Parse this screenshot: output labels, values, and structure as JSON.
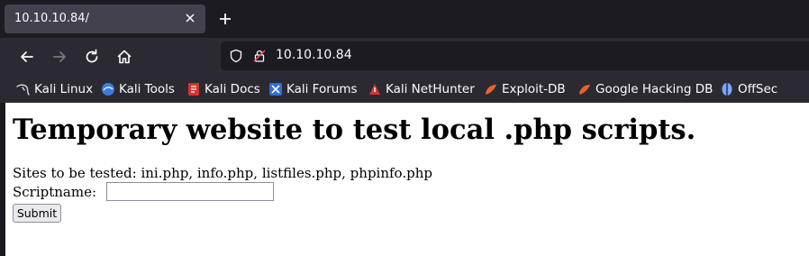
{
  "tab": {
    "title": "10.10.10.84/"
  },
  "navbar": {
    "url": "10.10.10.84"
  },
  "bookmarks": [
    {
      "label": "Kali Linux",
      "icon": "kali-dragon-icon"
    },
    {
      "label": "Kali Tools",
      "icon": "kali-tools-icon"
    },
    {
      "label": "Kali Docs",
      "icon": "kali-docs-icon"
    },
    {
      "label": "Kali Forums",
      "icon": "kali-forums-icon"
    },
    {
      "label": "Kali NetHunter",
      "icon": "kali-nethunter-icon"
    },
    {
      "label": "Exploit-DB",
      "icon": "exploit-db-icon"
    },
    {
      "label": "Google Hacking DB",
      "icon": "google-hacking-db-icon"
    },
    {
      "label": "OffSec",
      "icon": "offsec-icon"
    }
  ],
  "page": {
    "heading": "Temporary website to test local .php scripts.",
    "sites_text": "Sites to be tested: ini.php, info.php, listfiles.php, phpinfo.php",
    "script_label": "Scriptname:",
    "script_value": "",
    "submit_label": "Submit"
  },
  "colors": {
    "tabstrip_bg": "#1c1b22",
    "toolbar_bg": "#2b2a33",
    "active_tab_bg": "#42414d",
    "text_light": "#fbfbfe",
    "page_bg": "#ffffff"
  }
}
